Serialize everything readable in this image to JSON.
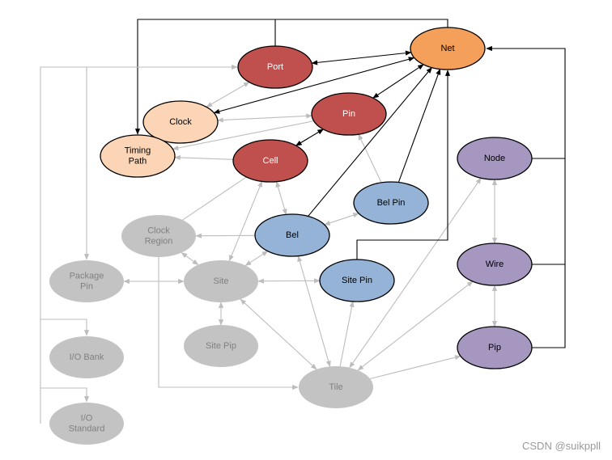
{
  "colors": {
    "net": "#f4a05a",
    "logical": "#c0504d",
    "timing": "#fbd5b5",
    "physical": "#95b3d7",
    "routing": "#a597c0",
    "device": "#c3c3c3",
    "black_edge": "#000000",
    "gray_edge": "#bdbdbd"
  },
  "nodes": [
    {
      "id": "net",
      "label": "Net",
      "group": "net"
    },
    {
      "id": "port",
      "label": "Port",
      "group": "logical"
    },
    {
      "id": "clock",
      "label": "Clock",
      "group": "timing"
    },
    {
      "id": "pin",
      "label": "Pin",
      "group": "logical"
    },
    {
      "id": "timing",
      "label": "Timing\nPath",
      "group": "timing"
    },
    {
      "id": "cell",
      "label": "Cell",
      "group": "logical"
    },
    {
      "id": "node",
      "label": "Node",
      "group": "routing"
    },
    {
      "id": "belpin",
      "label": "Bel Pin",
      "group": "physical"
    },
    {
      "id": "clkreg",
      "label": "Clock\nRegion",
      "group": "device"
    },
    {
      "id": "bel",
      "label": "Bel",
      "group": "physical"
    },
    {
      "id": "pkgpin",
      "label": "Package\nPin",
      "group": "device"
    },
    {
      "id": "site",
      "label": "Site",
      "group": "device"
    },
    {
      "id": "sitepin",
      "label": "Site Pin",
      "group": "physical"
    },
    {
      "id": "wire",
      "label": "Wire",
      "group": "routing"
    },
    {
      "id": "sitepip",
      "label": "Site Pip",
      "group": "device"
    },
    {
      "id": "iobank",
      "label": "I/O Bank",
      "group": "device"
    },
    {
      "id": "pip",
      "label": "Pip",
      "group": "routing"
    },
    {
      "id": "tile",
      "label": "Tile",
      "group": "device"
    },
    {
      "id": "iostd",
      "label": "I/O\nStandard",
      "group": "device"
    }
  ],
  "edges_black": [
    [
      "port",
      "net",
      "both"
    ],
    [
      "clock",
      "net",
      "both"
    ],
    [
      "pin",
      "net",
      "both"
    ],
    [
      "cell",
      "pin",
      "both"
    ],
    [
      "bel",
      "net",
      "to"
    ],
    [
      "belpin",
      "net",
      "to"
    ]
  ],
  "edges_gray": [
    [
      "port",
      "clock",
      "both"
    ],
    [
      "clock",
      "pin",
      "both"
    ],
    [
      "pin",
      "timing",
      "to"
    ],
    [
      "pin",
      "cell",
      "both"
    ],
    [
      "cell",
      "timing",
      "to"
    ],
    [
      "clkreg",
      "cell",
      "none"
    ],
    [
      "site",
      "cell",
      "both"
    ],
    [
      "bel",
      "cell",
      "both"
    ],
    [
      "belpin",
      "pin",
      "to"
    ],
    [
      "bel",
      "belpin",
      "both"
    ],
    [
      "clkreg",
      "site",
      "both"
    ],
    [
      "bel",
      "clkreg",
      "to"
    ],
    [
      "bel",
      "site",
      "both"
    ],
    [
      "pkgpin",
      "site",
      "both"
    ],
    [
      "site",
      "sitepin",
      "both"
    ],
    [
      "sitepip",
      "site",
      "both"
    ],
    [
      "tile",
      "site",
      "both"
    ],
    [
      "tile",
      "bel",
      "both"
    ],
    [
      "tile",
      "sitepin",
      "to"
    ],
    [
      "tile",
      "node",
      "both"
    ],
    [
      "tile",
      "wire",
      "both"
    ],
    [
      "tile",
      "pip",
      "to"
    ],
    [
      "node",
      "wire",
      "both"
    ],
    [
      "wire",
      "pip",
      "both"
    ]
  ],
  "watermark": "CSDN @suikppll"
}
